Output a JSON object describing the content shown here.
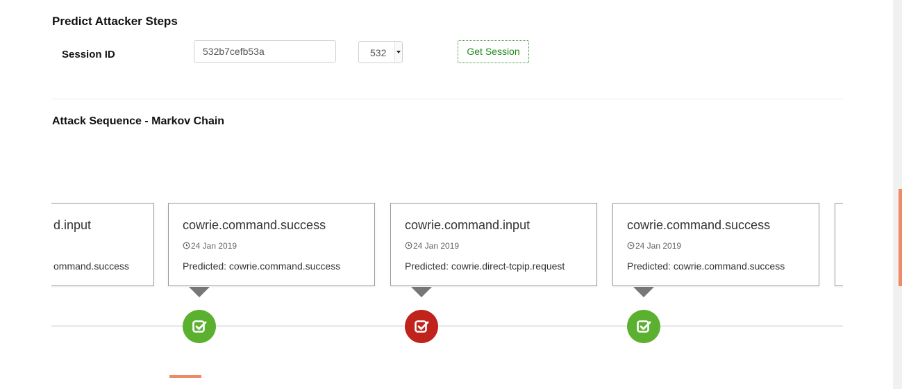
{
  "header": {
    "title": "Predict Attacker Steps"
  },
  "session": {
    "label": "Session ID",
    "input_value": "532b7cefb53a",
    "select_value": "532",
    "button_label": "Get Session"
  },
  "section": {
    "title": "Attack Sequence - Markov Chain"
  },
  "colors": {
    "success": "#5bb12f",
    "failure": "#c0221c",
    "accent": "#ee8a66"
  },
  "timeline": {
    "cards": [
      {
        "event": "cowrie.command.input",
        "date": "",
        "predicted": "Predicted: cowrie.command.success",
        "visible_event": "d.input",
        "visible_predicted": "ommand.success"
      },
      {
        "event": "cowrie.command.success",
        "date": "24 Jan 2019",
        "predicted": "Predicted: cowrie.command.success",
        "status": "success",
        "icon": "check-square-icon"
      },
      {
        "event": "cowrie.command.input",
        "date": "24 Jan 2019",
        "predicted": "Predicted: cowrie.direct-tcpip.request",
        "status": "failure",
        "icon": "check-square-icon"
      },
      {
        "event": "cowrie.command.success",
        "date": "24 Jan 2019",
        "predicted": "Predicted: cowrie.command.success",
        "status": "success",
        "icon": "check-square-icon"
      }
    ]
  }
}
